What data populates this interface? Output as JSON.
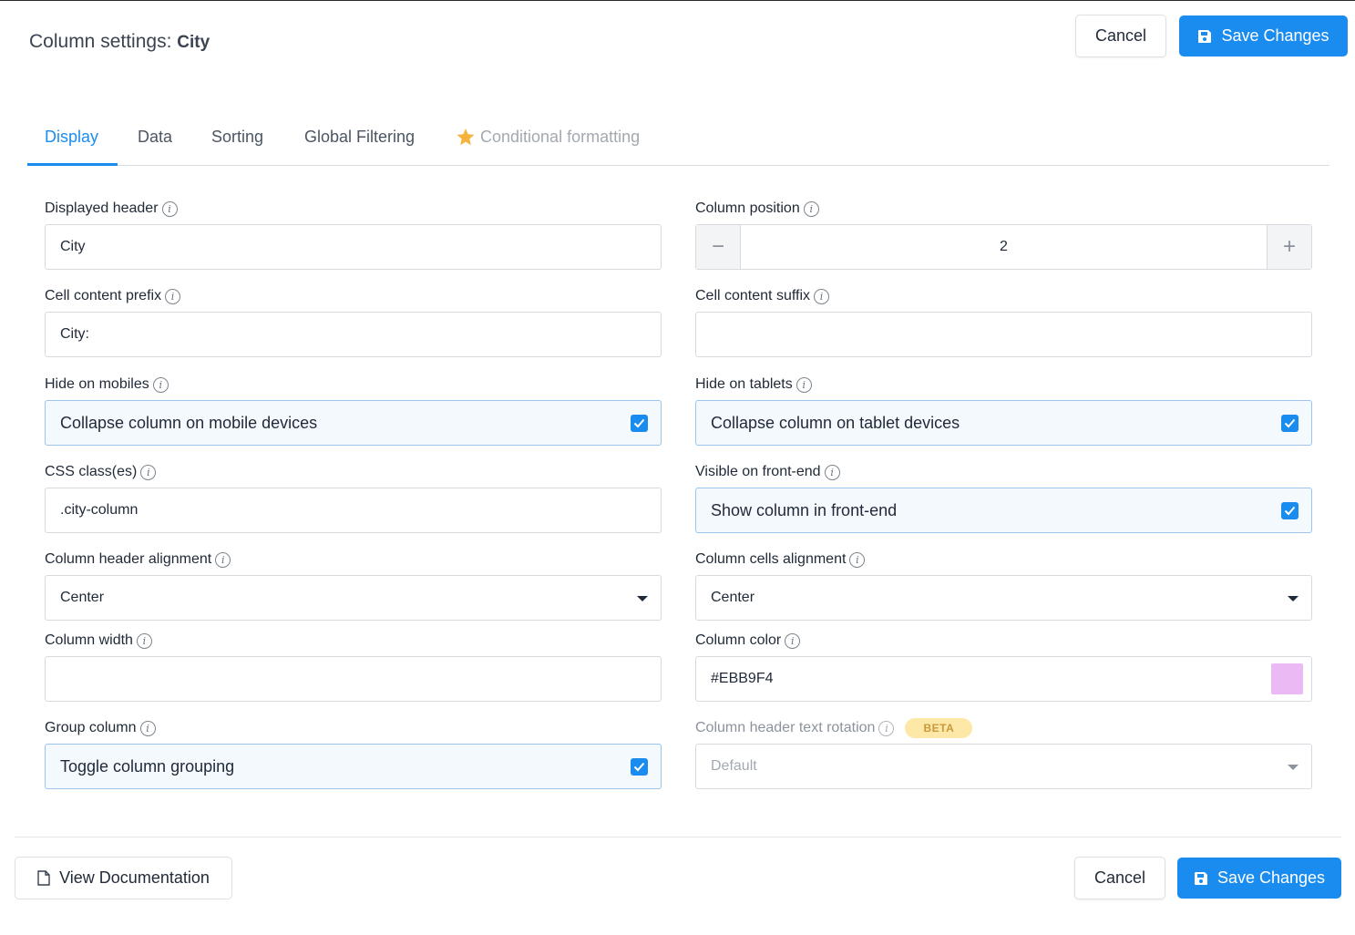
{
  "header": {
    "title_prefix": "Column settings:",
    "column_name": "City",
    "cancel_label": "Cancel",
    "save_label": "Save Changes"
  },
  "tabs": [
    {
      "label": "Display",
      "active": true
    },
    {
      "label": "Data",
      "active": false
    },
    {
      "label": "Sorting",
      "active": false
    },
    {
      "label": "Global Filtering",
      "active": false
    },
    {
      "label": "Conditional formatting",
      "active": false,
      "disabled": true,
      "icon": "star-icon"
    }
  ],
  "fields": {
    "displayed_header": {
      "label": "Displayed header",
      "value": "City"
    },
    "column_position": {
      "label": "Column position",
      "value": "2",
      "minus": "−",
      "plus": "+"
    },
    "cell_prefix": {
      "label": "Cell content prefix",
      "value": "City:"
    },
    "cell_suffix": {
      "label": "Cell content suffix",
      "value": ""
    },
    "hide_mobiles": {
      "label": "Hide on mobiles",
      "text": "Collapse column on mobile devices",
      "checked": true
    },
    "hide_tablets": {
      "label": "Hide on tablets",
      "text": "Collapse column on tablet devices",
      "checked": true
    },
    "css_classes": {
      "label": "CSS class(es)",
      "value": ".city-column"
    },
    "visible_frontend": {
      "label": "Visible on front-end",
      "text": "Show column in front-end",
      "checked": true
    },
    "header_alignment": {
      "label": "Column header alignment",
      "value": "Center"
    },
    "cells_alignment": {
      "label": "Column cells alignment",
      "value": "Center"
    },
    "column_width": {
      "label": "Column width",
      "value": ""
    },
    "column_color": {
      "label": "Column color",
      "value": "#EBB9F4",
      "swatch": "#EBB9F4"
    },
    "group_column": {
      "label": "Group column",
      "text": "Toggle column grouping",
      "checked": true
    },
    "header_rotation": {
      "label": "Column header text rotation",
      "badge": "BETA",
      "value": "Default",
      "disabled": true
    }
  },
  "footer": {
    "doc_label": "View Documentation",
    "cancel_label": "Cancel",
    "save_label": "Save Changes"
  },
  "colors": {
    "accent": "#1a8cf0",
    "beta_bg": "#fde8a8",
    "star": "#f5b33d"
  }
}
